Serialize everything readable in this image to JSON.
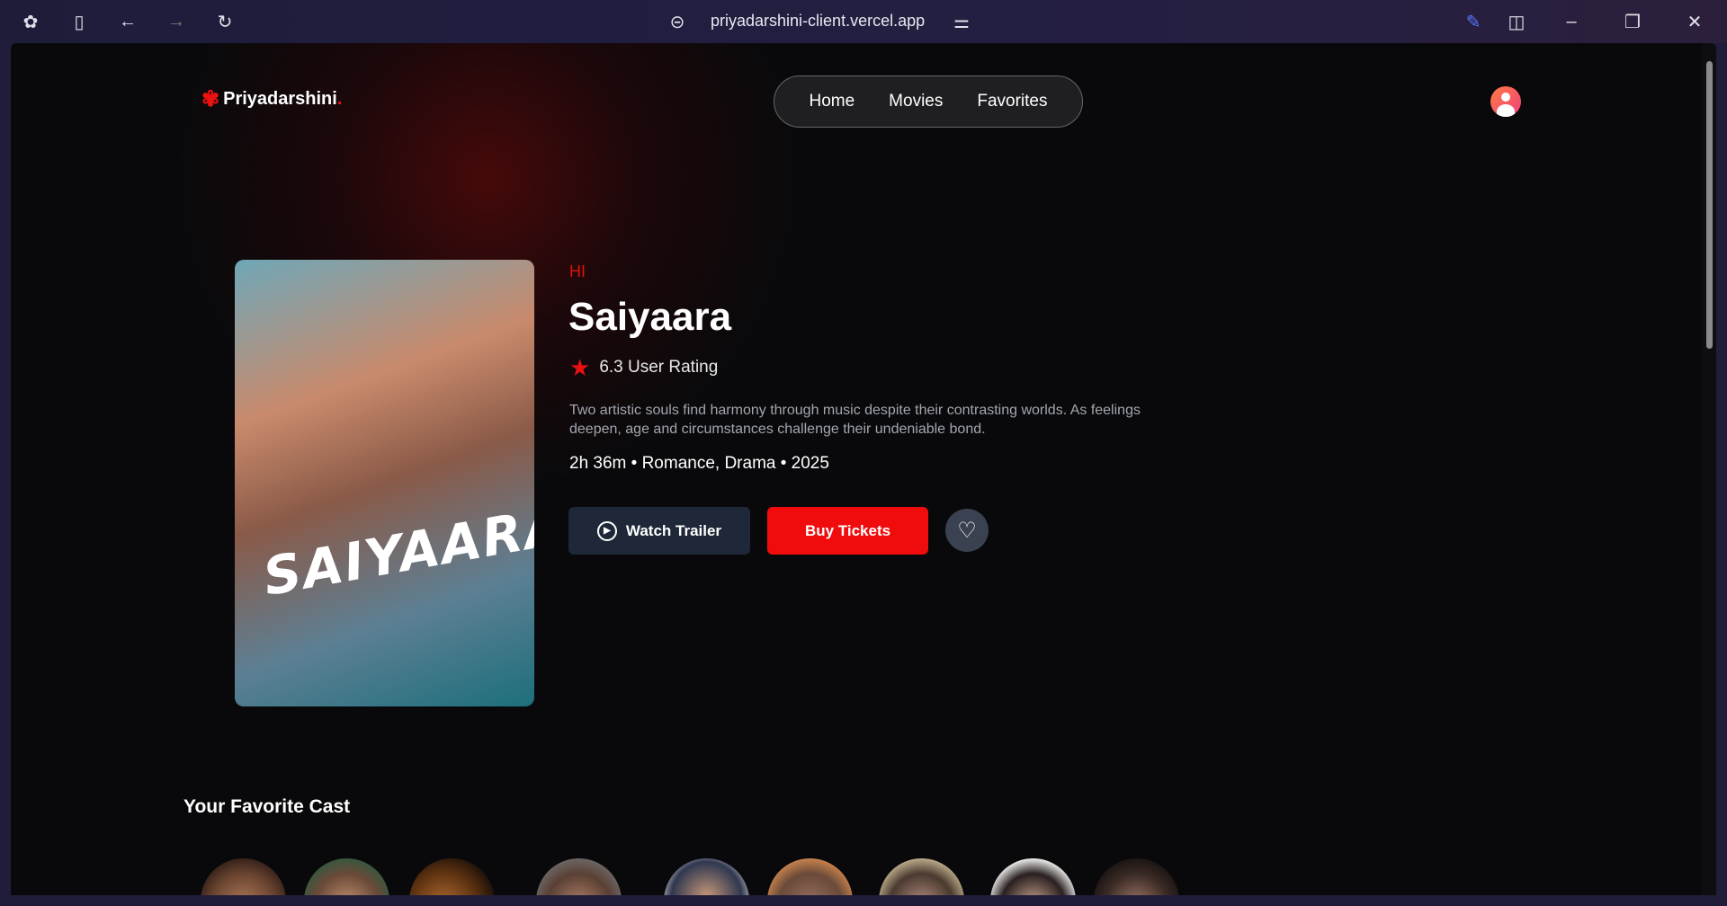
{
  "browser": {
    "url": "priyadarshini-client.vercel.app"
  },
  "header": {
    "logo_text": "Priyadarshini",
    "logo_dot": ".",
    "nav": [
      {
        "label": "Home"
      },
      {
        "label": "Movies"
      },
      {
        "label": "Favorites"
      }
    ]
  },
  "movie": {
    "poster_title": "SAIYAARA",
    "language": "HI",
    "title": "Saiyaara",
    "rating": "6.3 User Rating",
    "description": "Two artistic souls find harmony through music despite their contrasting worlds. As feelings deepen, age and circumstances challenge their undeniable bond.",
    "meta": "2h 36m • Romance, Drama • 2025",
    "watch_trailer": "Watch Trailer",
    "buy_tickets": "Buy Tickets"
  },
  "cast": {
    "title": "Your Favorite Cast",
    "count": 9
  },
  "colors": {
    "accent": "#f00c0c",
    "background": "#09090b"
  }
}
